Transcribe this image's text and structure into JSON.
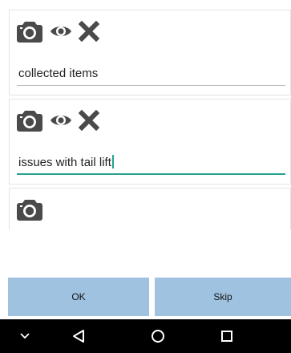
{
  "items": [
    {
      "note_value": "collected items",
      "has_preview": true,
      "has_delete": true,
      "focused": false
    },
    {
      "note_value": "issues with tail lift",
      "has_preview": true,
      "has_delete": true,
      "focused": true
    },
    {
      "has_preview": false,
      "has_delete": false
    }
  ],
  "icons": {
    "camera": "camera-icon",
    "preview": "eye-icon",
    "delete": "close-icon"
  },
  "buttons": {
    "ok_label": "OK",
    "skip_label": "Skip"
  },
  "navbar": {
    "items": [
      "chevron-down-icon",
      "back-triangle-icon",
      "home-circle-icon",
      "recents-square-icon"
    ]
  },
  "colors": {
    "button_bg": "#9fc2e0",
    "focus_underline": "#27a08e",
    "icon_gray": "#4a4a4a",
    "navbar_bg": "#000000"
  }
}
